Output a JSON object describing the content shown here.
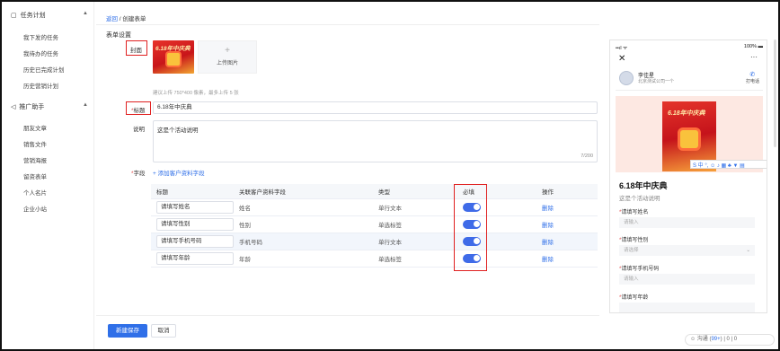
{
  "sidebar": {
    "groups": [
      {
        "label": "任务计划",
        "items": [
          "我下发的任务",
          "我待办的任务",
          "历史已完成计划",
          "历史营销计划"
        ]
      },
      {
        "label": "推广助手",
        "items": [
          "朋友文章",
          "销售文件",
          "营销海报",
          "留资表单",
          "个人名片",
          "企业小站"
        ]
      }
    ]
  },
  "breadcrumb": {
    "back": "返回",
    "separator": " / ",
    "current": "创建表单"
  },
  "section_title": "表单设置",
  "form": {
    "cover_label": "封面",
    "cover_text": "6.18年中庆典",
    "upload_label": "上传图片",
    "upload_plus": "+",
    "upload_hint": "建议上传 750*400 像素，最多上传 5 张",
    "title_label": "标题",
    "title_required": "*",
    "title_value": "6.18年中庆典",
    "desc_label": "说明",
    "desc_value": "这是个活动说明",
    "desc_counter": "7/200",
    "fields_label": "字段",
    "fields_required": "*",
    "add_field": "+ 添加客户资料字段"
  },
  "table": {
    "headers": [
      "标题",
      "关联客户资料字段",
      "类型",
      "必填",
      "操作"
    ],
    "rows": [
      {
        "title": "请填写姓名",
        "field": "姓名",
        "type": "单行文本",
        "required": true,
        "action": "删除"
      },
      {
        "title": "请填写性别",
        "field": "性别",
        "type": "单选标签",
        "required": true,
        "action": "删除"
      },
      {
        "title": "请填写手机号码",
        "field": "手机号码",
        "type": "单行文本",
        "required": true,
        "action": "删除"
      },
      {
        "title": "请填写年龄",
        "field": "年龄",
        "type": "单选标签",
        "required": true,
        "action": "删除"
      }
    ]
  },
  "buttons": {
    "save": "新建保存",
    "cancel": "取消"
  },
  "preview": {
    "signal": "••ıl ᯤ",
    "battery": "100%",
    "user_name": "李佳星",
    "user_sub": "北京测试公司一个",
    "call_label": "打电话",
    "poster_text": "6.18年中庆典",
    "title": "6.18年中庆典",
    "desc": "这是个活动说明",
    "ime_bar": "S 中 °, ☺ ♪ ▦ ♣ ▼ ▤",
    "fields": [
      {
        "label": "请填写姓名",
        "placeholder": "请输入",
        "select": false
      },
      {
        "label": "请填写性别",
        "placeholder": "请选择",
        "select": true
      },
      {
        "label": "请填写手机号码",
        "placeholder": "请输入",
        "select": false
      },
      {
        "label": "请填写年龄",
        "placeholder": "",
        "select": false
      }
    ]
  },
  "feedback": {
    "label": "☺ 沟通 (",
    "count": "99+",
    "rest": ") | 0 | 0"
  },
  "colors": {
    "primary": "#2f6fe8",
    "required": "#e34d4d",
    "highlight_box": "#e02020"
  }
}
